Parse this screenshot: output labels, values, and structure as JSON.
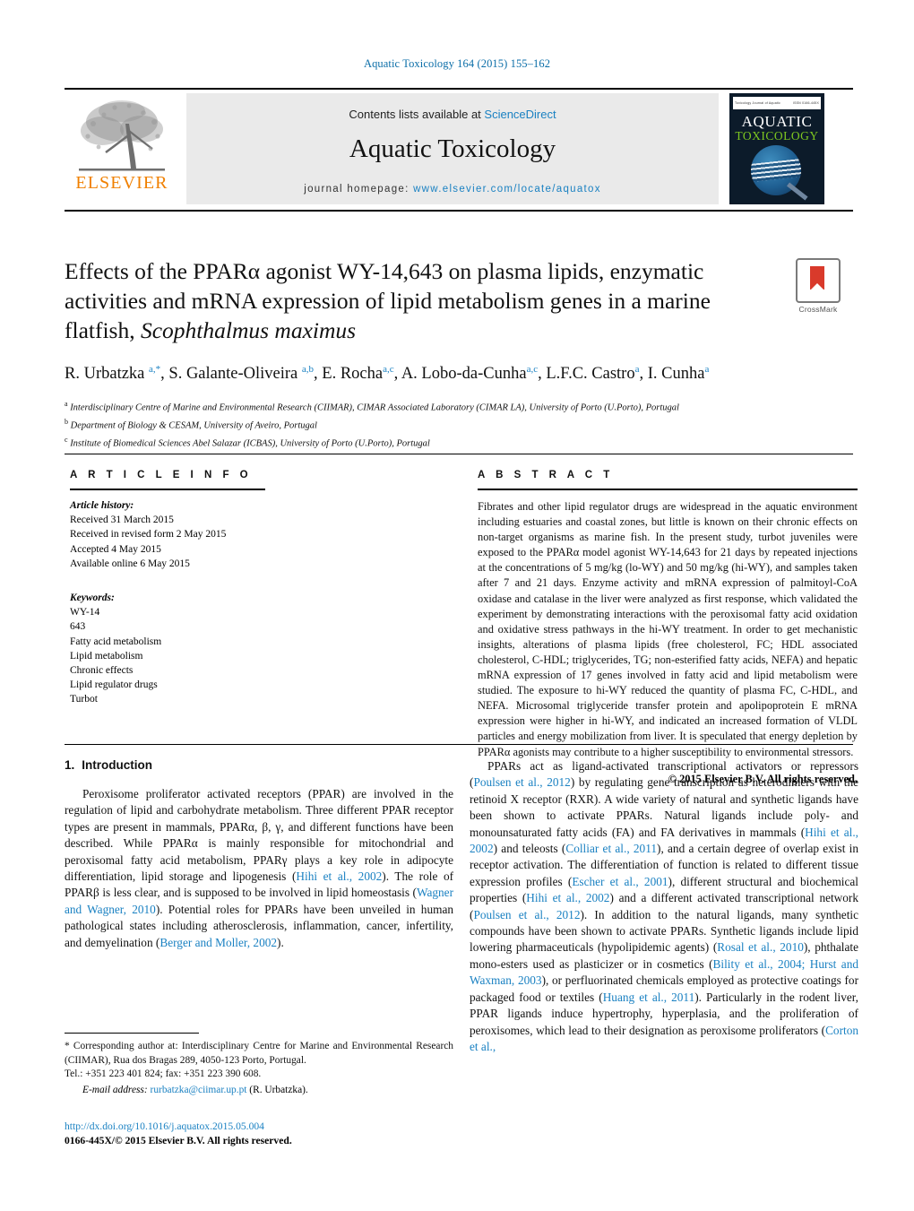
{
  "running_head": "Aquatic Toxicology 164 (2015) 155–162",
  "masthead": {
    "contents_prefix": "Contents lists available at ",
    "sciencedirect": "ScienceDirect",
    "journal_title": "Aquatic Toxicology",
    "homepage_prefix": "journal homepage: ",
    "homepage_url": "www.elsevier.com/locate/aquatox",
    "publisher_logo_text": "ELSEVIER",
    "cover": {
      "line_left": "Toxicology Journal of Aquatic",
      "line_right": "ISSN 0166-445X",
      "title_top": "AQUATIC",
      "title_bottom": "TOXICOLOGY"
    },
    "accent_link_color": "#1a81c2",
    "elsevier_orange": "#f08000"
  },
  "crossmark": {
    "label": "CrossMark"
  },
  "article": {
    "title_line1": "Effects of the PPARα agonist WY-14,643 on plasma lipids, enzymatic",
    "title_line2": "activities and mRNA expression of lipid metabolism genes in a marine",
    "title_line3_plain": "flatfish, ",
    "title_line3_italic": "Scophthalmus maximus",
    "authors_html": "R. Urbatzka <sup>a,*</sup>, S. Galante-Oliveira <sup>a,b</sup>, E. Rocha<sup>a,c</sup>, A. Lobo-da-Cunha<sup>a,c</sup>, L.F.C. Castro<sup>a</sup>, I. Cunha<sup>a</sup>",
    "affiliations": [
      {
        "mark": "a",
        "text": "Interdisciplinary Centre of Marine and Environmental Research (CIIMAR), CIMAR Associated Laboratory (CIMAR LA), University of Porto (U.Porto), Portugal"
      },
      {
        "mark": "b",
        "text": "Department of Biology & CESAM, University of Aveiro, Portugal"
      },
      {
        "mark": "c",
        "text": "Institute of Biomedical Sciences Abel Salazar (ICBAS), University of Porto (U.Porto), Portugal"
      }
    ]
  },
  "article_info": {
    "heading": "A R T I C L E  I N F O",
    "history_label": "Article history:",
    "history": [
      "Received 31 March 2015",
      "Received in revised form 2 May 2015",
      "Accepted 4 May 2015",
      "Available online 6 May 2015"
    ],
    "keywords_label": "Keywords:",
    "keywords": [
      "WY-14",
      "643",
      "Fatty acid metabolism",
      "Lipid metabolism",
      "Chronic effects",
      "Lipid regulator drugs",
      "Turbot"
    ]
  },
  "abstract": {
    "heading": "A B S T R A C T",
    "text": "Fibrates and other lipid regulator drugs are widespread in the aquatic environment including estuaries and coastal zones, but little is known on their chronic effects on non-target organisms as marine fish. In the present study, turbot juveniles were exposed to the PPARα model agonist WY-14,643 for 21 days by repeated injections at the concentrations of 5 mg/kg (lo-WY) and 50 mg/kg (hi-WY), and samples taken after 7 and 21 days. Enzyme activity and mRNA expression of palmitoyl-CoA oxidase and catalase in the liver were analyzed as first response, which validated the experiment by demonstrating interactions with the peroxisomal fatty acid oxidation and oxidative stress pathways in the hi-WY treatment. In order to get mechanistic insights, alterations of plasma lipids (free cholesterol, FC; HDL associated cholesterol, C-HDL; triglycerides, TG; non-esterified fatty acids, NEFA) and hepatic mRNA expression of 17 genes involved in fatty acid and lipid metabolism were studied. The exposure to hi-WY reduced the quantity of plasma FC, C-HDL, and NEFA. Microsomal triglyceride transfer protein and apolipoprotein E mRNA expression were higher in hi-WY, and indicated an increased formation of VLDL particles and energy mobilization from liver. It is speculated that energy depletion by PPARα agonists may contribute to a higher susceptibility to environmental stressors.",
    "copyright": "© 2015 Elsevier B.V. All rights reserved."
  },
  "introduction": {
    "number": "1.",
    "heading": "Introduction",
    "left_paragraphs": [
      "Peroxisome proliferator activated receptors (PPAR) are involved in the regulation of lipid and carbohydrate metabolism. Three different PPAR receptor types are present in mammals, PPARα, β, γ, and different functions have been described. While PPARα is mainly responsible for mitochondrial and peroxisomal fatty acid metabolism, PPARγ plays a key role in adipocyte differentiation, lipid storage and lipogenesis (§Hihi et al., 2002§). The role of PPARβ is less clear, and is supposed to be involved in lipid homeostasis (§Wagner and Wagner, 2010§). Potential roles for PPARs have been unveiled in human pathological states including atherosclerosis, inflammation, cancer, infertility, and demyelination (§Berger and Moller, 2002§)."
    ],
    "right_paragraphs": [
      "PPARs act as ligand-activated transcriptional activators or repressors (§Poulsen et al., 2012§) by regulating gene transcription as heterodimers with the retinoid X receptor (RXR). A wide variety of natural and synthetic ligands have been shown to activate PPARs. Natural ligands include poly- and monounsaturated fatty acids (FA) and FA derivatives in mammals (§Hihi et al., 2002§) and teleosts (§Colliar et al., 2011§), and a certain degree of overlap exist in receptor activation. The differentiation of function is related to different tissue expression profiles (§Escher et al., 2001§), different structural and biochemical properties (§Hihi et al., 2002§) and a different activated transcriptional network (§Poulsen et al., 2012§). In addition to the natural ligands, many synthetic compounds have been shown to activate PPARs. Synthetic ligands include lipid lowering pharmaceuticals (hypolipidemic agents) (§Rosal et al., 2010§), phthalate mono-esters used as plasticizer or in cosmetics (§Bility et al., 2004; Hurst and Waxman, 2003§), or perfluorinated chemicals employed as protective coatings for packaged food or textiles (§Huang et al., 2011§). Particularly in the rodent liver, PPAR ligands induce hypertrophy, hyperplasia, and the proliferation of peroxisomes, which lead to their designation as peroxisome proliferators (§Corton et al.,§"
    ]
  },
  "footnote": {
    "corresponding": "* Corresponding author at: Interdisciplinary Centre for Marine and Environmental Research (CIIMAR), Rua dos Bragas 289, 4050-123 Porto, Portugal.",
    "phone": "Tel.: +351 223 401 824; fax: +351 223 390 608.",
    "email_label": "E-mail address:",
    "email": "rurbatzka@ciimar.up.pt",
    "email_suffix": "(R. Urbatzka)."
  },
  "footer": {
    "doi": "http://dx.doi.org/10.1016/j.aquatox.2015.05.004",
    "issn_line": "0166-445X/© 2015 Elsevier B.V. All rights reserved."
  }
}
